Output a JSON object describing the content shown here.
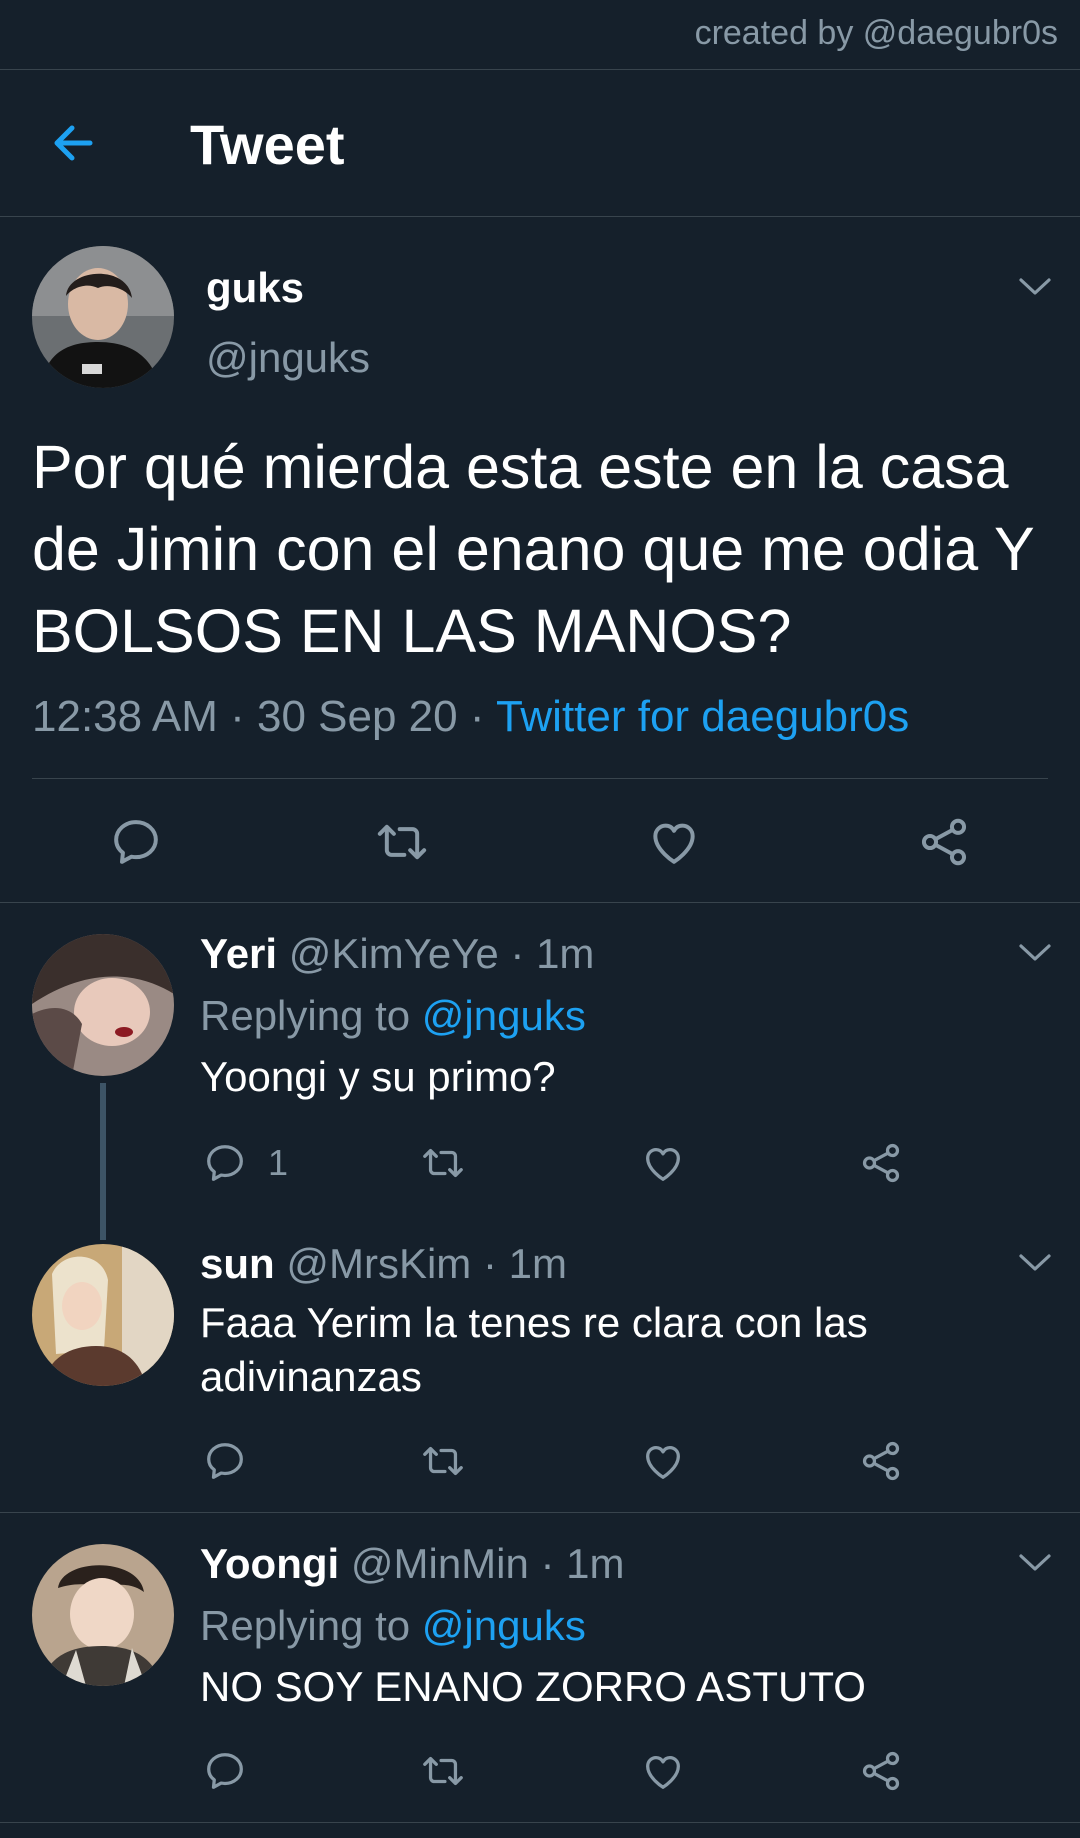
{
  "credit": "created by @daegubr0s",
  "header": {
    "title": "Tweet"
  },
  "main_tweet": {
    "name": "guks",
    "handle": "@jnguks",
    "text": "Por qué mierda esta este en la casa de Jimin con el enano que me odia Y BOLSOS EN LAS MANOS?",
    "time": "12:38 AM · 30 Sep 20 · ",
    "source": "Twitter for daegubr0s"
  },
  "replies": [
    {
      "name": "Yeri",
      "handle": "@KimYeYe · 1m",
      "replying_prefix": "Replying to ",
      "replying_to": "@jnguks",
      "text": "Yoongi y su primo?",
      "reply_count": "1"
    },
    {
      "name": "sun",
      "handle": "@MrsKim · 1m",
      "text": "Faaa Yerim la tenes re clara con las adivinanzas"
    },
    {
      "name": "Yoongi",
      "handle": "@MinMin · 1m",
      "replying_prefix": "Replying to ",
      "replying_to": "@jnguks",
      "text": "NO SOY ENANO ZORRO ASTUTO"
    }
  ],
  "colors": {
    "background": "#15202b",
    "accent": "#1da1f2",
    "muted": "#8899a6",
    "divider": "#38444d"
  }
}
